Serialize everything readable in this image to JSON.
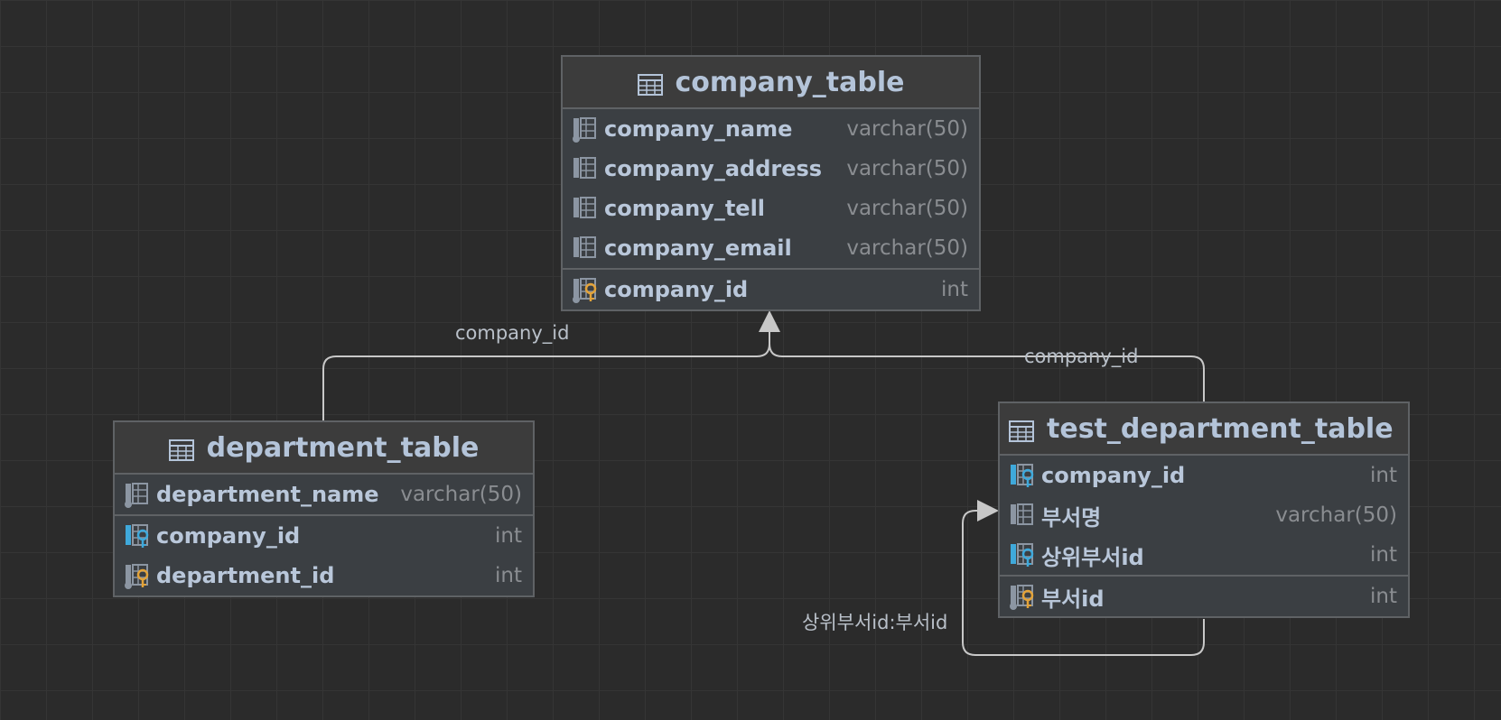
{
  "tables": {
    "company": {
      "name": "company_table",
      "columns": [
        {
          "name": "company_name",
          "type": "varchar(50)",
          "icon": "column-notnull-icon"
        },
        {
          "name": "company_address",
          "type": "varchar(50)",
          "icon": "column-icon"
        },
        {
          "name": "company_tell",
          "type": "varchar(50)",
          "icon": "column-icon"
        },
        {
          "name": "company_email",
          "type": "varchar(50)",
          "icon": "column-icon"
        }
      ],
      "keys": [
        {
          "name": "company_id",
          "type": "int",
          "icon": "primary-key-icon"
        }
      ]
    },
    "department": {
      "name": "department_table",
      "columns": [
        {
          "name": "department_name",
          "type": "varchar(50)",
          "icon": "column-notnull-icon"
        }
      ],
      "keys": [
        {
          "name": "company_id",
          "type": "int",
          "icon": "foreign-key-icon"
        },
        {
          "name": "department_id",
          "type": "int",
          "icon": "primary-key-icon"
        }
      ]
    },
    "test_department": {
      "name": "test_department_table",
      "columns": [
        {
          "name": "company_id",
          "type": "int",
          "icon": "foreign-key-icon"
        },
        {
          "name": "부서명",
          "type": "varchar(50)",
          "icon": "column-icon"
        },
        {
          "name": "상위부서id",
          "type": "int",
          "icon": "foreign-key-icon"
        }
      ],
      "keys": [
        {
          "name": "부서id",
          "type": "int",
          "icon": "primary-key-icon"
        }
      ]
    }
  },
  "edges": {
    "department_to_company": "company_id",
    "test_department_to_company": "company_id",
    "self_reference": "상위부서id:부서id"
  },
  "colors": {
    "background": "#2b2b2b",
    "table_fill": "#3b3f43",
    "table_border": "#5f6265",
    "column_text": "#b9c7da",
    "type_text": "#8a8d91",
    "primary_key": "#e3a33a",
    "foreign_key": "#3fa9db",
    "edge_line": "#c8c8c8"
  }
}
